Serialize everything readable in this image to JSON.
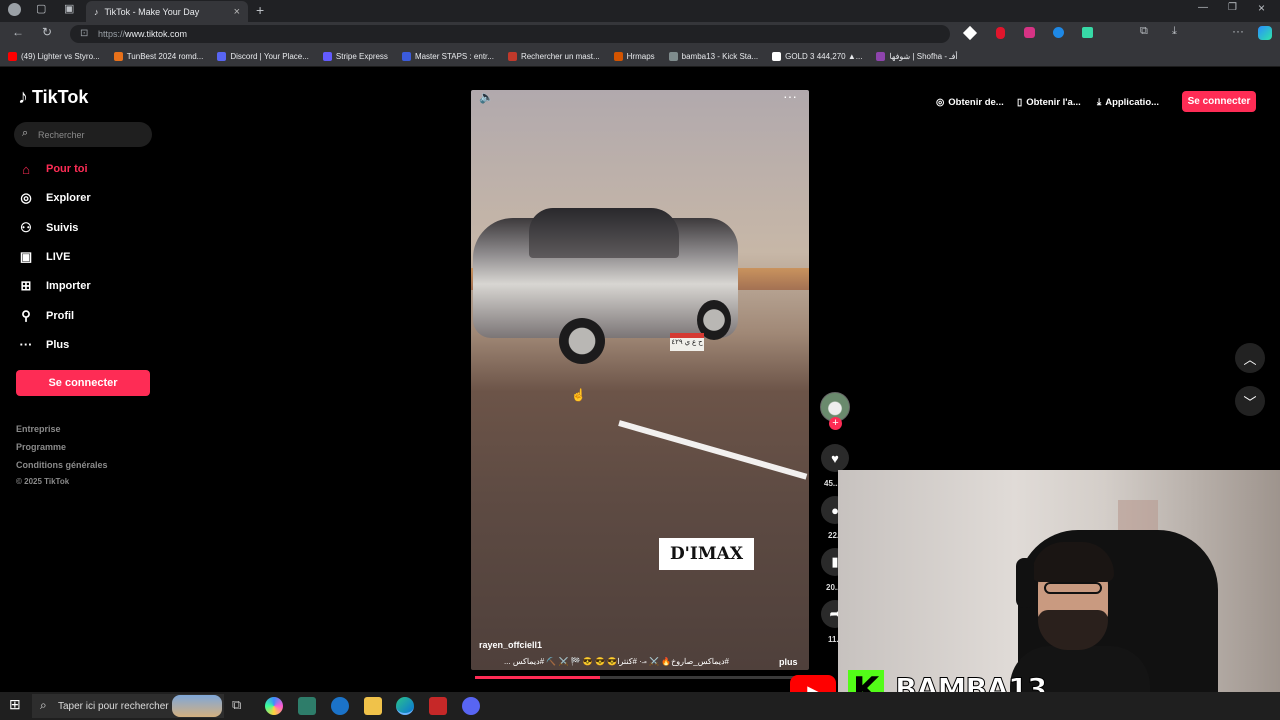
{
  "browser": {
    "tab_title": "TikTok - Make Your Day",
    "url_scheme": "https://",
    "url_host": "www.tiktok.com",
    "bookmarks": [
      {
        "label": "(49) Lighter vs Styro...",
        "color": "#ff0000"
      },
      {
        "label": "TunBest 2024 romd...",
        "color": "#e8711a"
      },
      {
        "label": "Discord | Your Place...",
        "color": "#5865f2"
      },
      {
        "label": "Stripe Express",
        "color": "#635bff"
      },
      {
        "label": "Master STAPS : entr...",
        "color": "#3b5bdb"
      },
      {
        "label": "Rechercher un mast...",
        "color": "#c0392b"
      },
      {
        "label": "Hrmaps",
        "color": "#d35400"
      },
      {
        "label": "bamba13 - Kick Sta...",
        "color": "#7f8c8d"
      },
      {
        "label": "GOLD 3 444,270 ▲...",
        "color": "#ffffff"
      },
      {
        "label": "شوفها | Shofha - أفـ",
        "color": "#8e44ad"
      }
    ]
  },
  "tiktok": {
    "logo": "TikTok",
    "search_placeholder": "Rechercher",
    "nav": [
      {
        "label": "Pour toi",
        "icon": "home-icon",
        "glyph": "⌂"
      },
      {
        "label": "Explorer",
        "icon": "compass-icon",
        "glyph": "◎"
      },
      {
        "label": "Suivis",
        "icon": "following-icon",
        "glyph": "⚇"
      },
      {
        "label": "LIVE",
        "icon": "live-icon",
        "glyph": "▣"
      },
      {
        "label": "Importer",
        "icon": "upload-icon",
        "glyph": "⊞"
      },
      {
        "label": "Profil",
        "icon": "profile-icon",
        "glyph": "⚲"
      },
      {
        "label": "Plus",
        "icon": "more-icon",
        "glyph": "···"
      }
    ],
    "login_button": "Se connecter",
    "footer": [
      "Entreprise",
      "Programme",
      "Conditions générales"
    ],
    "copyright": "© 2025 TikTok",
    "top_actions": [
      "Obtenir de...",
      "Obtenir l'a...",
      "Applicatio..."
    ],
    "top_login": "Se connecter",
    "accent": "#fe2c55"
  },
  "video": {
    "overlay_text": "D'IMAX",
    "plate_text": "ح ع ي ٤٢٩",
    "username": "rayen_offciell1",
    "caption": "#ديماكس_صاروخ🔥 ⚔️ -̶ ·͏ #كنترا😎 😎 😎 🏁 ⚔️ ⛏️ #ديماكس ...",
    "more": "plus",
    "progress": 0.38,
    "counts": {
      "likes": "45...",
      "comments": "22...",
      "saves": "20...",
      "shares": "11..."
    }
  },
  "stream": {
    "brand": "BAMBA13",
    "kick_letter": "K",
    "youtube_glyph": "▶"
  },
  "taskbar": {
    "search_placeholder": "Taper ici pour rechercher",
    "start_glyph": "⊞"
  }
}
